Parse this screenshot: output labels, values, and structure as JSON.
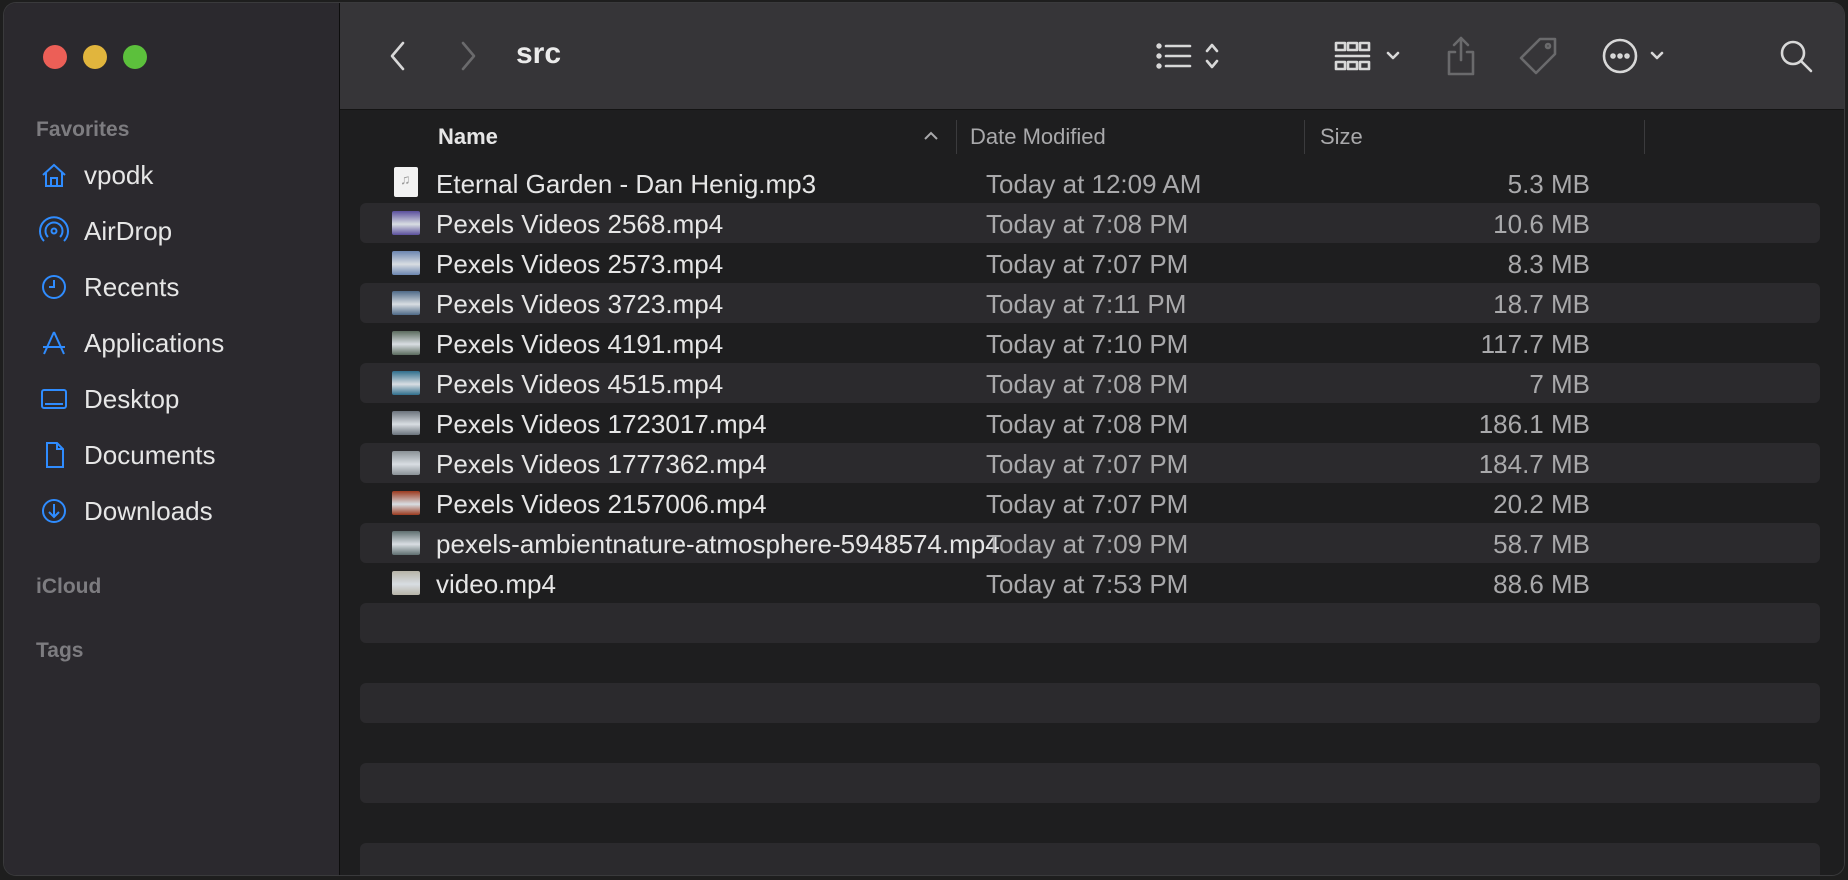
{
  "sidebar": {
    "favorites_title": "Favorites",
    "items": [
      {
        "label": "vpodk",
        "icon": "house-icon"
      },
      {
        "label": "AirDrop",
        "icon": "airdrop-icon"
      },
      {
        "label": "Recents",
        "icon": "clock-icon"
      },
      {
        "label": "Applications",
        "icon": "applications-icon"
      },
      {
        "label": "Desktop",
        "icon": "desktop-icon"
      },
      {
        "label": "Documents",
        "icon": "document-icon"
      },
      {
        "label": "Downloads",
        "icon": "download-icon"
      }
    ],
    "icloud_title": "iCloud",
    "tags_title": "Tags"
  },
  "toolbar": {
    "title": "src"
  },
  "columns": {
    "name": "Name",
    "date": "Date Modified",
    "size": "Size"
  },
  "files": [
    {
      "name": "Eternal Garden - Dan Henig.mp3",
      "date": "Today at 12:09 AM",
      "size": "5.3 MB",
      "thumb": "audio"
    },
    {
      "name": "Pexels Videos 2568.mp4",
      "date": "Today at 7:08 PM",
      "size": "10.6 MB",
      "thumb": "#5a4f9c"
    },
    {
      "name": "Pexels Videos 2573.mp4",
      "date": "Today at 7:07 PM",
      "size": "8.3 MB",
      "thumb": "#6c86b0"
    },
    {
      "name": "Pexels Videos 3723.mp4",
      "date": "Today at 7:11 PM",
      "size": "18.7 MB",
      "thumb": "#4f6a88"
    },
    {
      "name": "Pexels Videos 4191.mp4",
      "date": "Today at 7:10 PM",
      "size": "117.7 MB",
      "thumb": "#5b6b5e"
    },
    {
      "name": "Pexels Videos 4515.mp4",
      "date": "Today at 7:08 PM",
      "size": "7 MB",
      "thumb": "#2f6e8c"
    },
    {
      "name": "Pexels Videos 1723017.mp4",
      "date": "Today at 7:08 PM",
      "size": "186.1 MB",
      "thumb": "#6b737c"
    },
    {
      "name": "Pexels Videos 1777362.mp4",
      "date": "Today at 7:07 PM",
      "size": "184.7 MB",
      "thumb": "#8a9196"
    },
    {
      "name": "Pexels Videos 2157006.mp4",
      "date": "Today at 7:07 PM",
      "size": "20.2 MB",
      "thumb": "#9b3a1f"
    },
    {
      "name": "pexels-ambientnature-atmosphere-5948574.mp4",
      "date": "Today at 7:09 PM",
      "size": "58.7 MB",
      "thumb": "#5f6f70"
    },
    {
      "name": "video.mp4",
      "date": "Today at 7:53 PM",
      "size": "88.6 MB",
      "thumb": "#b7b4a8"
    }
  ]
}
